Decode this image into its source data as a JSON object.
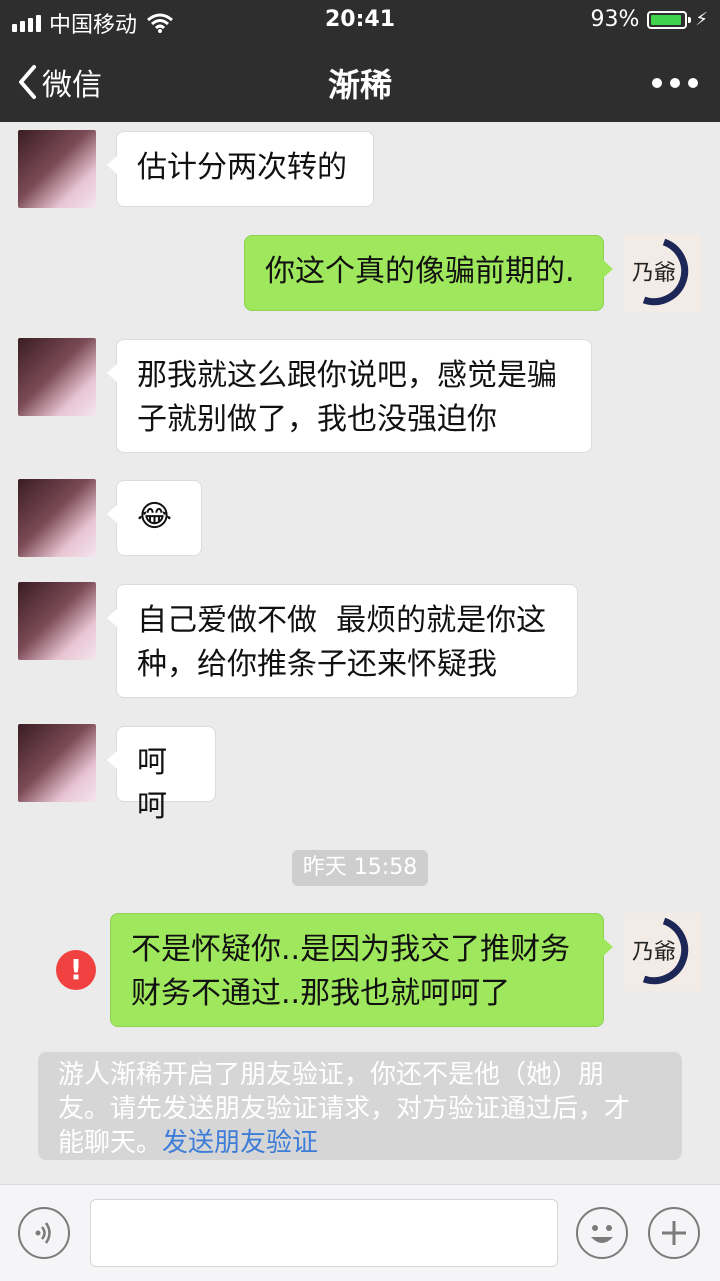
{
  "status_bar": {
    "carrier": "中国移动",
    "time": "20:41",
    "battery": "93%",
    "battery_level": 0.93
  },
  "nav": {
    "back_label": "微信",
    "title": "渐稀"
  },
  "messages": [
    {
      "side": "in",
      "text": "估计分两次转的"
    },
    {
      "side": "out",
      "text": "你这个真的像骗前期的."
    },
    {
      "side": "in",
      "lines": [
        "那我就这么跟你说吧，感觉是骗",
        "子就别做了，我也没强迫你"
      ]
    },
    {
      "side": "in",
      "text": "😂"
    },
    {
      "side": "in",
      "lines": [
        "自己爱做不做  最烦的就是你这",
        "种，给你推条子还来怀疑我"
      ]
    },
    {
      "side": "in",
      "text": "呵呵"
    },
    {
      "side": "out",
      "lines": [
        "不是怀疑你..是因为我交了推财务",
        "财务不通过..那我也就呵呵了"
      ],
      "failed": true
    }
  ],
  "timestamp": "昨天 15:58",
  "error_icon_glyph": "!",
  "self_avatar_text": "乃爺",
  "system_note": {
    "line1": "游人渐稀开启了朋友验证，你还不是他（她）朋",
    "line2": "友。请先发送朋友验证请求，对方验证通过后，才",
    "line3_text": "能聊天。",
    "link": "发送朋友验证"
  },
  "colors": {
    "bar_bg": "#2e2e2e",
    "chat_bg": "#ebebeb",
    "out_bubble": "#9fe85d",
    "in_bubble": "#ffffff",
    "error": "#f0403f",
    "link": "#3d7dd8",
    "battery_fill": "#3fd24a"
  },
  "icons": [
    "signal-icon",
    "wifi-icon",
    "battery-icon",
    "charging-icon",
    "back-chevron-icon",
    "more-icon",
    "voice-icon",
    "emoji-icon",
    "plus-icon",
    "error-icon"
  ]
}
